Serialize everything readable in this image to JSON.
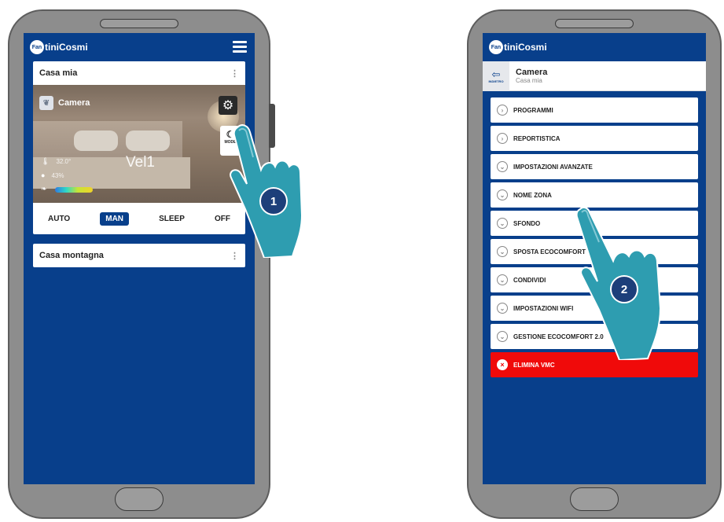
{
  "brand": {
    "logo_mark": "Fan",
    "logo_text": "tiniCosmi"
  },
  "left": {
    "home_card_title": "Casa mia",
    "room_name": "Camera",
    "mode_label": "MODE",
    "temperature": "32.0°",
    "humidity": "43%",
    "speed": "Vel1",
    "modes": [
      "AUTO",
      "MAN",
      "SLEEP",
      "OFF"
    ],
    "active_mode": "MAN",
    "second_card_title": "Casa montagna"
  },
  "right": {
    "back_label": "INDIETRO",
    "room_title": "Camera",
    "room_sub": "Casa mia",
    "menu": [
      "PROGRAMMI",
      "REPORTISTICA",
      "IMPOSTAZIONI AVANZATE",
      "NOME ZONA",
      "SFONDO",
      "SPOSTA ECOCOMFORT",
      "CONDIVIDI",
      "IMPOSTAZIONI WIFI",
      "GESTIONE ECOCOMFORT 2.0"
    ],
    "delete_label": "ELIMINA VMC"
  },
  "steps": {
    "step1": "1",
    "step2": "2"
  },
  "colors": {
    "app_blue": "#083f8b",
    "danger_red": "#f00a0a",
    "phone_gray": "#8d8d8d",
    "hand_teal": "#2e9db0"
  },
  "icons": [
    "hamburger-icon",
    "kebab-icon",
    "gear-icon",
    "mode-icon",
    "thermometer-icon",
    "drop-icon",
    "leaf-icon",
    "back-icon",
    "chevron-icon",
    "close-icon",
    "pointing-hand-icon"
  ]
}
